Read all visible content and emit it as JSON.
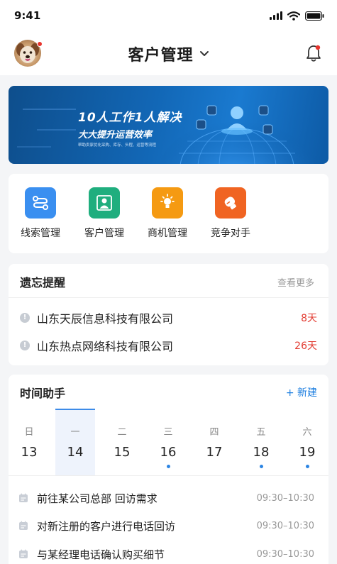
{
  "status_bar": {
    "time": "9:41"
  },
  "header": {
    "title": "客户管理"
  },
  "banner": {
    "title": "10人工作1人解决",
    "subtitle": "大大提升运营效率",
    "caption": "帮助卖家优化采购、库存、头程、运营等流程"
  },
  "quick_menu": [
    {
      "label": "线索管理",
      "color": "#3a8ff0",
      "icon": "route-icon"
    },
    {
      "label": "客户管理",
      "color": "#1fae7e",
      "icon": "person-icon"
    },
    {
      "label": "商机管理",
      "color": "#f59a12",
      "icon": "bulb-icon"
    },
    {
      "label": "竞争对手",
      "color": "#f06422",
      "icon": "boxing-glove-icon"
    }
  ],
  "memo": {
    "title": "遗忘提醒",
    "more": "查看更多",
    "items": [
      {
        "name": "山东天辰信息科技有限公司",
        "days": "8天"
      },
      {
        "name": "山东热点网络科技有限公司",
        "days": "26天"
      }
    ]
  },
  "time_assistant": {
    "title": "时间助手",
    "new_label": "+ 新建",
    "week": [
      {
        "weekday": "日",
        "date": "13",
        "selected": false,
        "has_event": false
      },
      {
        "weekday": "一",
        "date": "14",
        "selected": true,
        "has_event": false
      },
      {
        "weekday": "二",
        "date": "15",
        "selected": false,
        "has_event": false
      },
      {
        "weekday": "三",
        "date": "16",
        "selected": false,
        "has_event": true
      },
      {
        "weekday": "四",
        "date": "17",
        "selected": false,
        "has_event": false
      },
      {
        "weekday": "五",
        "date": "18",
        "selected": false,
        "has_event": true
      },
      {
        "weekday": "六",
        "date": "19",
        "selected": false,
        "has_event": true
      }
    ],
    "schedule": [
      {
        "title": "前往某公司总部 回访需求",
        "time": "09:30–10:30"
      },
      {
        "title": "对新注册的客户进行电话回访",
        "time": "09:30–10:30"
      },
      {
        "title": "与某经理电话确认购买细节",
        "time": "09:30–10:30"
      }
    ]
  }
}
